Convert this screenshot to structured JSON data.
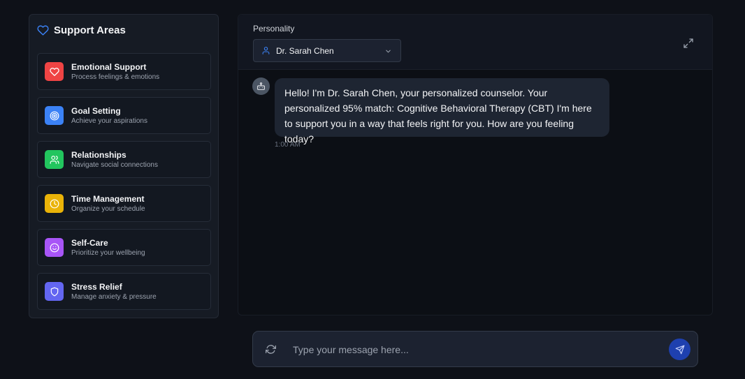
{
  "sidebar": {
    "title": "Support Areas",
    "items": [
      {
        "title": "Emotional Support",
        "subtitle": "Process feelings & emotions",
        "color": "#ef4444",
        "icon": "heart-icon"
      },
      {
        "title": "Goal Setting",
        "subtitle": "Achieve your aspirations",
        "color": "#3b82f6",
        "icon": "target-icon"
      },
      {
        "title": "Relationships",
        "subtitle": "Navigate social connections",
        "color": "#22c55e",
        "icon": "users-icon"
      },
      {
        "title": "Time Management",
        "subtitle": "Organize your schedule",
        "color": "#eab308",
        "icon": "clock-icon"
      },
      {
        "title": "Self-Care",
        "subtitle": "Prioritize your wellbeing",
        "color": "#a855f7",
        "icon": "smile-icon"
      },
      {
        "title": "Stress Relief",
        "subtitle": "Manage anxiety & pressure",
        "color": "#6366f1",
        "icon": "shield-icon"
      }
    ]
  },
  "header": {
    "personality_label": "Personality",
    "personality_value": "Dr. Sarah Chen"
  },
  "messages": [
    {
      "sender": "bot",
      "text": "Hello! I'm Dr. Sarah Chen, your personalized counselor. Your personalized 95% match: Cognitive Behavioral Therapy (CBT) I'm here to support you in a way that feels right for you. How are you feeling today?",
      "time": "1:00 AM"
    }
  ],
  "input": {
    "placeholder": "Type your message here...",
    "value": ""
  },
  "colors": {
    "accent": "#3b82f6",
    "send": "#1e40af"
  }
}
